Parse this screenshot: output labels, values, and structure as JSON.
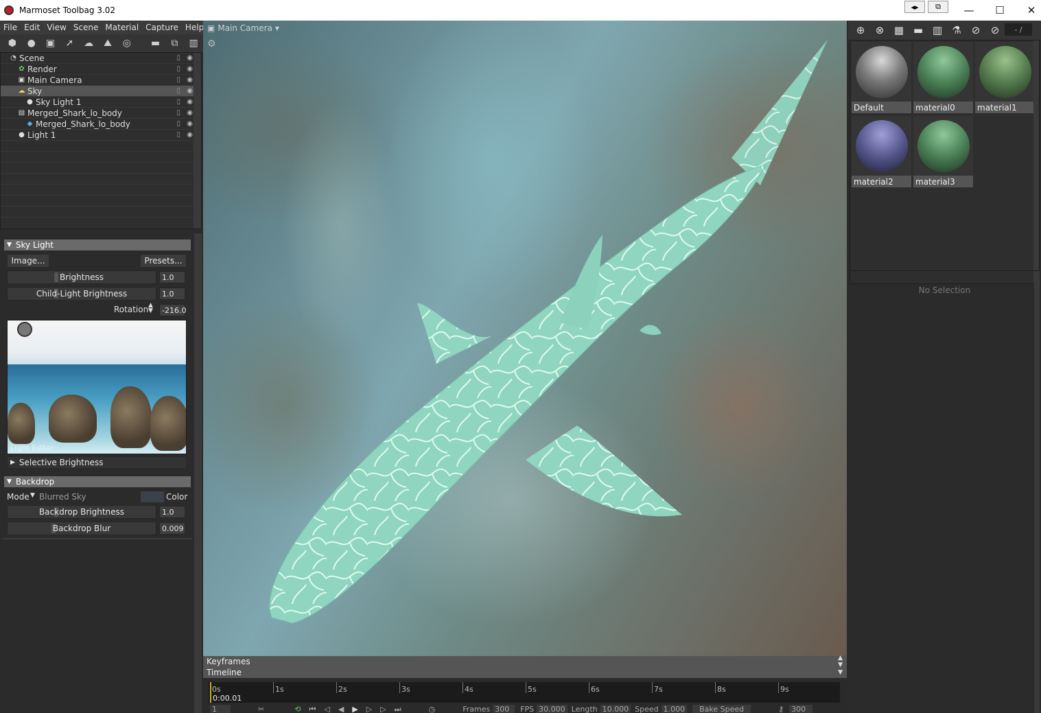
{
  "window": {
    "title": "Marmoset Toolbag 3.02",
    "minimize_glyph": "—",
    "maximize_glyph": "☐",
    "close_glyph": "✕",
    "extra1_glyph": "◂▸",
    "extra2_glyph": "⧉"
  },
  "menu": [
    "File",
    "Edit",
    "View",
    "Scene",
    "Material",
    "Capture",
    "Help"
  ],
  "scene_toolbar": {
    "icons": [
      "cube-icon",
      "bulb-icon",
      "camera-icon",
      "shark-icon",
      "cloud-icon",
      "sky-icon",
      "swirl-icon",
      "folder-icon",
      "duplicate-icon",
      "trash-icon"
    ]
  },
  "scene_tree": [
    {
      "label": "Scene",
      "indent": 0,
      "icon": "◔",
      "selected": false
    },
    {
      "label": "Render",
      "indent": 1,
      "icon": "✿",
      "selected": false
    },
    {
      "label": "Main Camera",
      "indent": 1,
      "icon": "▣",
      "selected": false
    },
    {
      "label": "Sky",
      "indent": 1,
      "icon": "☁",
      "selected": true
    },
    {
      "label": "Sky Light 1",
      "indent": 2,
      "icon": "●",
      "selected": false
    },
    {
      "label": "Merged_Shark_lo_body",
      "indent": 1,
      "icon": "▤",
      "selected": false
    },
    {
      "label": "Merged_Shark_lo_body",
      "indent": 2,
      "icon": "◆",
      "selected": false
    },
    {
      "label": "Light 1",
      "indent": 1,
      "icon": "●",
      "selected": false
    }
  ],
  "sky_light": {
    "header": "Sky Light",
    "image_button": "Image...",
    "presets_button": "Presets...",
    "brightness_label": "Brightness",
    "brightness_value": "1.0",
    "child_brightness_label": "Child-Light Brightness",
    "child_brightness_value": "1.0",
    "rotation_label": "Rotation",
    "rotation_value": "-216.0",
    "preview_label": "Light Editor",
    "selective_brightness": "Selective Brightness"
  },
  "backdrop": {
    "header": "Backdrop",
    "mode_label": "Mode",
    "mode_value": "Blurred Sky",
    "color_label": "Color",
    "brightness_label": "Backdrop Brightness",
    "brightness_value": "1.0",
    "blur_label": "Backdrop Blur",
    "blur_value": "0.009"
  },
  "viewport": {
    "camera_label": "Main Camera",
    "dropdown_glyph": "▾"
  },
  "timeline": {
    "keyframes_label": "Keyframes",
    "timeline_label": "Timeline",
    "ticks": [
      "0s",
      "1s",
      "2s",
      "3s",
      "4s",
      "5s",
      "6s",
      "7s",
      "8s",
      "9s"
    ],
    "timecode": "0:00.01",
    "frame_field": "1",
    "frames_label": "Frames",
    "frames_value": "300",
    "fps_label": "FPS",
    "fps_value": "30.000",
    "length_label": "Length",
    "length_value": "10.000",
    "speed_label": "Speed",
    "speed_value": "1.000",
    "bake_speed": "Bake Speed",
    "end_value": "300"
  },
  "materials": {
    "page_field": "- /",
    "items": [
      {
        "name": "Default",
        "color": "#8a8a8a"
      },
      {
        "name": "material0",
        "color": "#4c8a5c"
      },
      {
        "name": "material1",
        "color": "#5a8a5a"
      },
      {
        "name": "material2",
        "color": "#5a5a9a"
      },
      {
        "name": "material3",
        "color": "#4c8a5c"
      }
    ],
    "no_selection": "No Selection"
  }
}
